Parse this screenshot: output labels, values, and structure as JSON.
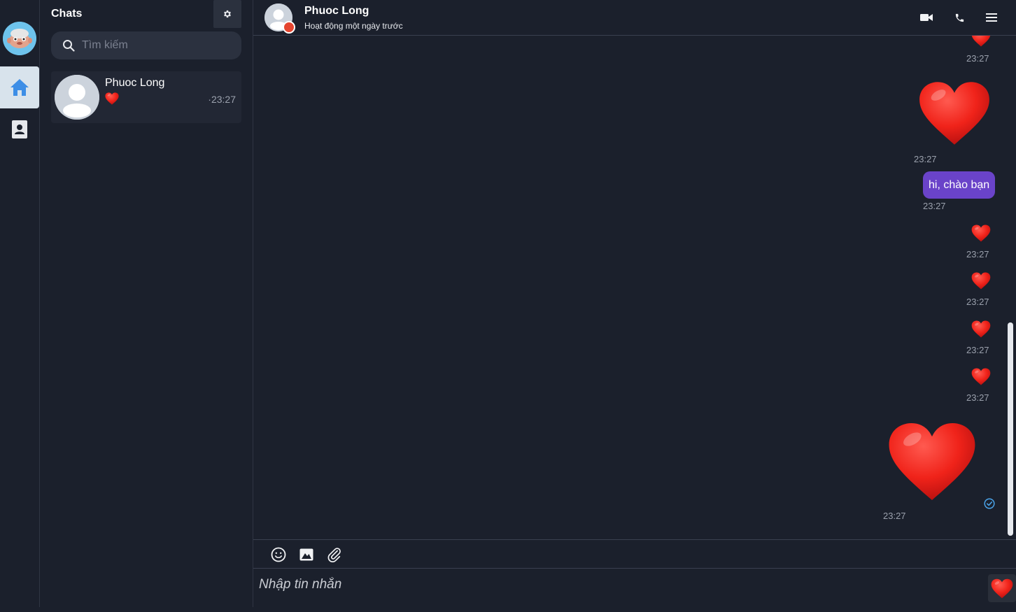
{
  "sidebar": {
    "title": "Chats",
    "search_placeholder": "Tìm kiếm",
    "conversations": [
      {
        "name": "Phuoc Long",
        "last_message": "❤️",
        "time": "·23:27"
      }
    ]
  },
  "conversation": {
    "name": "Phuoc Long",
    "status": "Hoạt động một ngày trước",
    "messages": [
      {
        "type": "heart",
        "size": "small",
        "time": "23:27"
      },
      {
        "type": "heart",
        "size": "large",
        "time": "23:27"
      },
      {
        "type": "text",
        "text": "hi, chào bạn",
        "time": "23:27"
      },
      {
        "type": "heart",
        "size": "small",
        "time": "23:27"
      },
      {
        "type": "heart",
        "size": "small",
        "time": "23:27"
      },
      {
        "type": "heart",
        "size": "small",
        "time": "23:27"
      },
      {
        "type": "heart",
        "size": "small",
        "time": "23:27"
      },
      {
        "type": "heart",
        "size": "large",
        "time": "23:27",
        "seen": true
      }
    ]
  },
  "composer": {
    "placeholder": "Nhập tin nhắn"
  },
  "colors": {
    "background": "#1b202c",
    "bubble": "#6a43c9",
    "heart": "#e8201a",
    "status_offline": "#e5452f",
    "seen": "#4aa3e8"
  }
}
